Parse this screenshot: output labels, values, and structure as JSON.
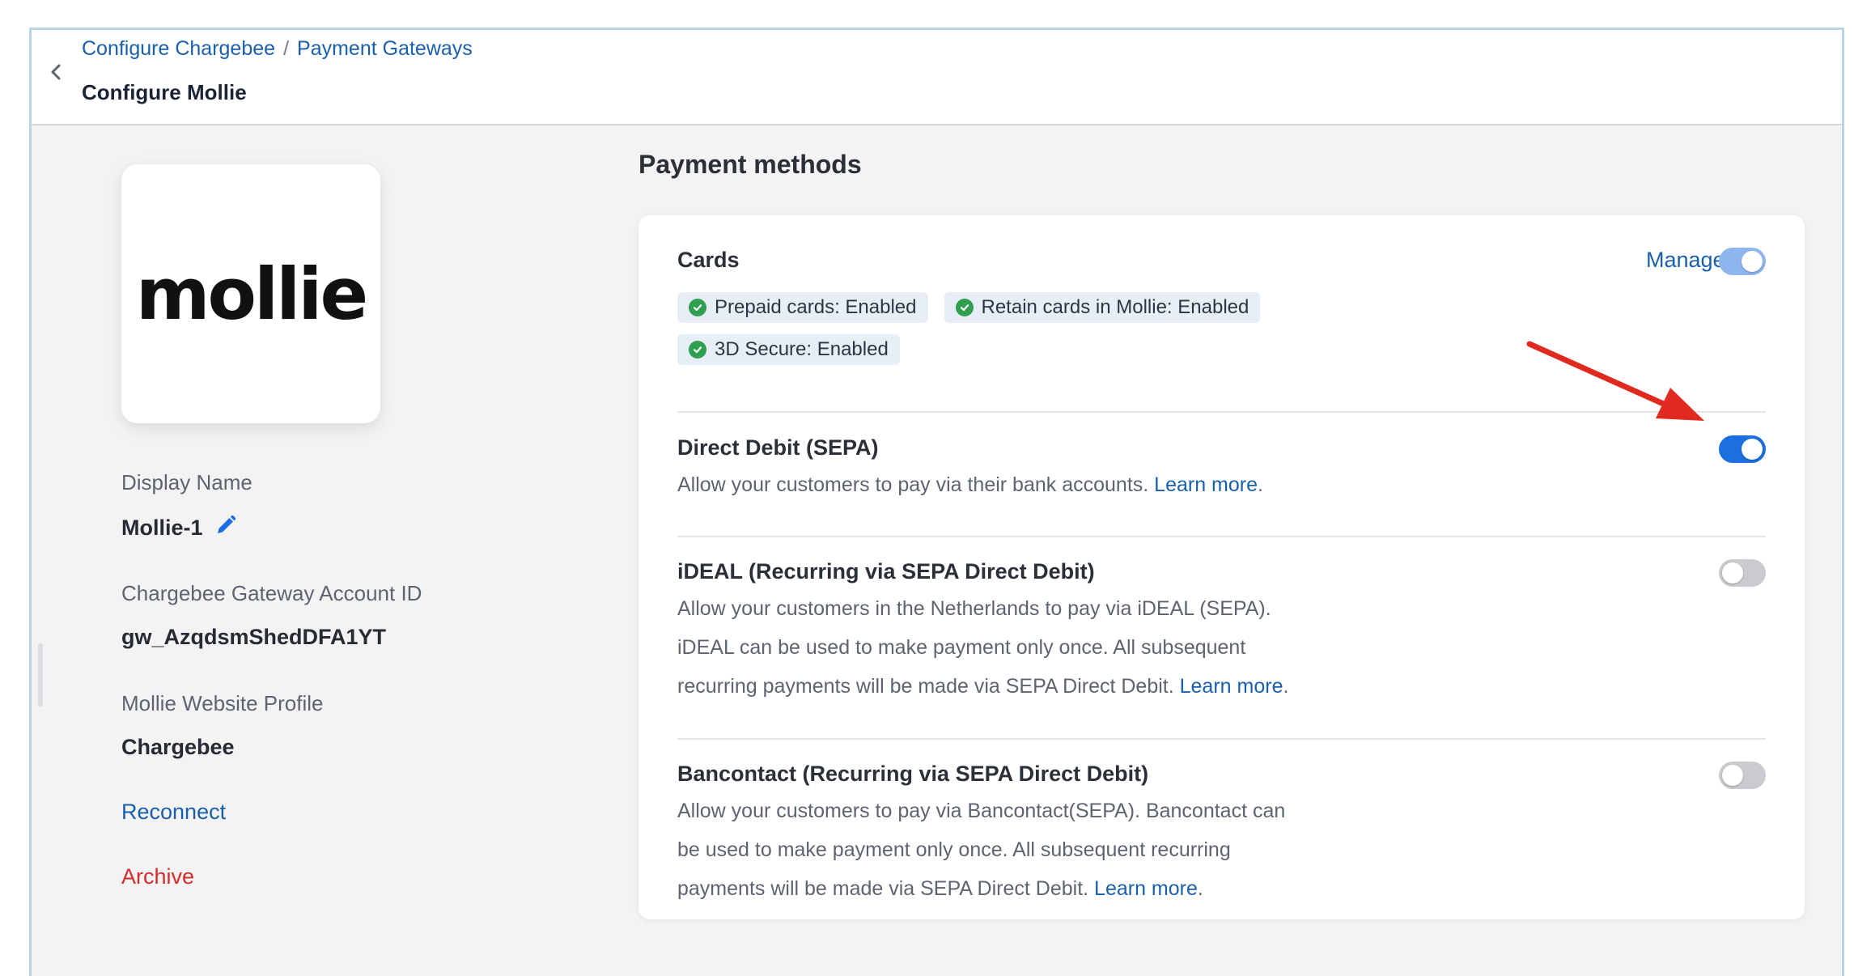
{
  "breadcrumb": {
    "items": [
      "Configure Chargebee",
      "Payment Gateways"
    ],
    "separator": "/"
  },
  "header": {
    "title": "Configure Mollie"
  },
  "gateway": {
    "logo_text": "mollie",
    "display_name_label": "Display Name",
    "display_name": "Mollie-1",
    "account_id_label": "Chargebee Gateway Account ID",
    "account_id": "gw_AzqdsmShedDFA1YT",
    "website_profile_label": "Mollie Website Profile",
    "website_profile": "Chargebee",
    "reconnect_label": "Reconnect",
    "archive_label": "Archive"
  },
  "payment_methods": {
    "title": "Payment methods",
    "cards": {
      "title": "Cards",
      "manage_label": "Manage",
      "enabled": true,
      "badges": [
        "Prepaid cards: Enabled",
        "Retain cards in Mollie: Enabled",
        "3D Secure: Enabled"
      ]
    },
    "sepa": {
      "title": "Direct Debit (SEPA)",
      "description": "Allow your customers to pay via their bank accounts.",
      "learn_more": "Learn more",
      "enabled": true
    },
    "ideal": {
      "title": "iDEAL (Recurring via SEPA Direct Debit)",
      "line1": "Allow your customers in the Netherlands to pay via iDEAL (SEPA).",
      "line2": "iDEAL can be used to make payment only once. All subsequent",
      "line3": "recurring payments will be made via SEPA Direct Debit.",
      "learn_more": "Learn more",
      "enabled": false
    },
    "bancontact": {
      "title": "Bancontact (Recurring via SEPA Direct Debit)",
      "line1": "Allow your customers to pay via Bancontact(SEPA). Bancontact can",
      "line2": "be used to make payment only once. All subsequent recurring",
      "line3": "payments will be made via SEPA Direct Debit.",
      "learn_more": "Learn more",
      "enabled": false
    }
  },
  "colors": {
    "link": "#1a5fac",
    "danger": "#d42b2b",
    "toggle_on": "#1c6fe0",
    "badge_check": "#2e9e4f",
    "annotation_arrow": "#e02a1f"
  }
}
